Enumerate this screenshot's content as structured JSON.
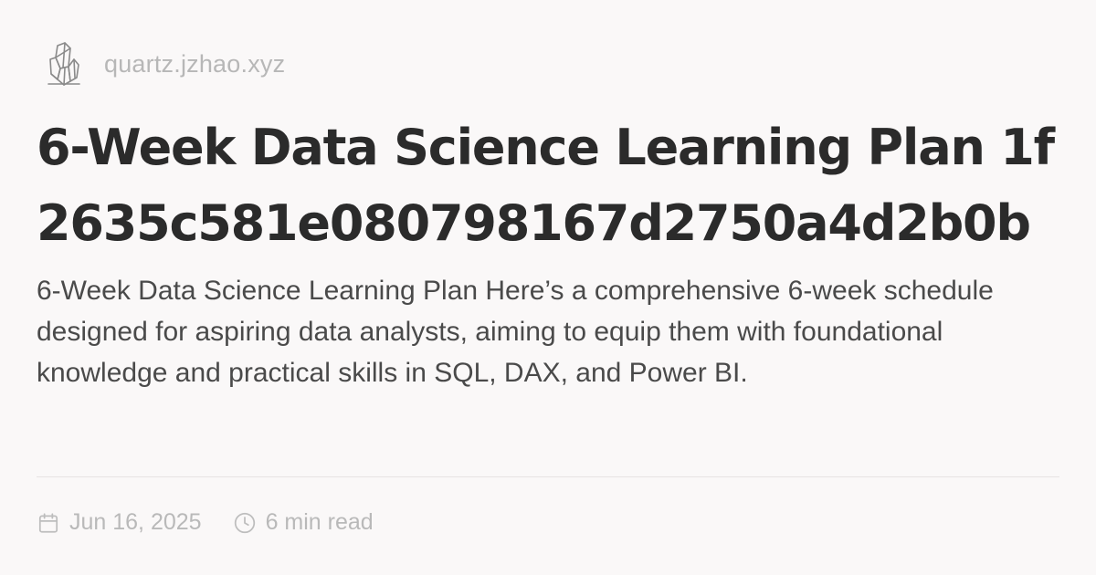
{
  "site": {
    "domain": "quartz.jzhao.xyz",
    "logo_icon": "crystal-logo-icon"
  },
  "page": {
    "title": "6-Week Data Science Learning Plan 1f2635c581e080798167d2750a4d2b0b",
    "description": "6-Week Data Science Learning Plan Here’s a comprehensive 6-week schedule designed for aspiring data analysts, aiming to equip them with foundational knowledge and practical skills in SQL, DAX, and Power BI."
  },
  "meta": {
    "date": "Jun 16, 2025",
    "date_icon": "calendar-icon",
    "read_time": "6 min read",
    "read_time_icon": "clock-icon"
  },
  "colors": {
    "background": "#faf8f8",
    "title": "#2b2b2b",
    "muted": "#b9b9b9"
  }
}
